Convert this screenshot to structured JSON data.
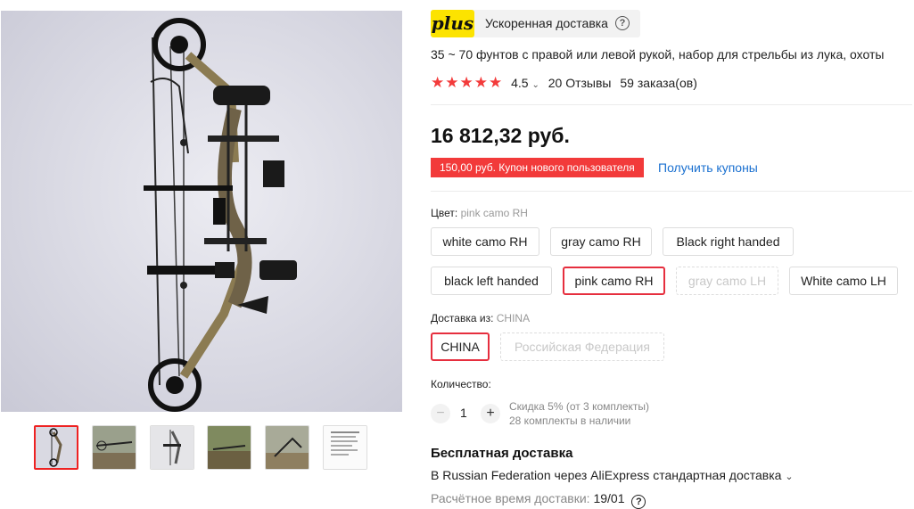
{
  "plus": {
    "logo": "plus",
    "text": "Ускоренная доставка",
    "help": "?"
  },
  "product": {
    "title": "35 ~ 70 фунтов с правой или левой рукой, набор для стрельбы из лука, охоты",
    "rating": "4.5",
    "stars": "★★★★★",
    "reviews": "20 Отзывы",
    "orders": "59 заказа(ов)",
    "price": "16 812,32 руб."
  },
  "coupon": {
    "text": "150,00 руб. Купон нового пользователя",
    "link": "Получить купоны"
  },
  "color": {
    "label": "Цвет:",
    "selected": "pink camo RH",
    "options": [
      "white camo RH",
      "gray camo RH",
      "Black right handed",
      "black left handed",
      "pink camo RH",
      "gray camo LH",
      "White camo LH"
    ]
  },
  "ship_from": {
    "label": "Доставка из:",
    "selected": "CHINA",
    "options": [
      "CHINA",
      "Российская Федерация"
    ]
  },
  "quantity": {
    "label": "Количество:",
    "value": "1",
    "minus": "−",
    "plus": "+",
    "discount": "Скидка 5% (от 3 комплекты)",
    "stock": "28 комплекты в наличии"
  },
  "shipping": {
    "title": "Бесплатная доставка",
    "method": "В Russian Federation через AliExpress стандартная доставка",
    "eta_label": "Расчётное время доставки:",
    "eta_date": "19/01",
    "help": "?"
  },
  "colors": {
    "accent": "#e62e3e",
    "coupon": "#f23a3a",
    "link": "#1a70d0",
    "star": "#f33b3b",
    "plus_badge": "#fce300"
  }
}
